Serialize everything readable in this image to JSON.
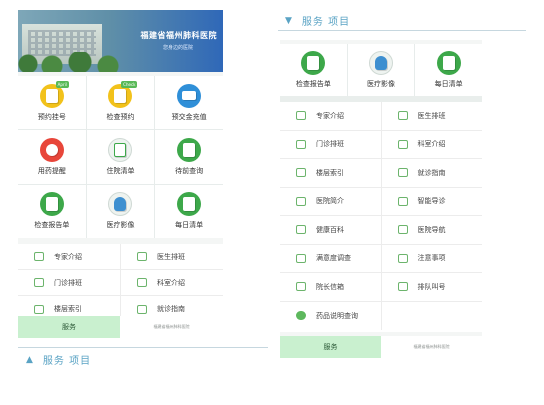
{
  "left_phone": {
    "banner": {
      "title": "福建省福州肺科医院",
      "subtitle": "您身边的医院"
    },
    "top_grid": [
      {
        "label": "预约挂号",
        "icon": "calendar-icon",
        "badge": "April",
        "color": "#f2c21b"
      },
      {
        "label": "检查预约",
        "icon": "calendar-check-icon",
        "badge": "Check",
        "color": "#f2c21b"
      },
      {
        "label": "预交金充值",
        "icon": "wallet-icon",
        "badge": "",
        "color": "#2f8fd8"
      },
      {
        "label": "用药提醒",
        "icon": "alarm-clock-icon",
        "badge": "",
        "color": "#2f8fd8"
      },
      {
        "label": "住院清单",
        "icon": "clipboard-icon",
        "badge": "",
        "color": "#eef3f0"
      },
      {
        "label": "待前查询",
        "icon": "search-doc-icon",
        "badge": "",
        "color": "#3da84a"
      },
      {
        "label": "检查报告单",
        "icon": "report-icon",
        "badge": "",
        "color": "#3da84a"
      },
      {
        "label": "医疗影像",
        "icon": "lungs-icon",
        "badge": "",
        "color": "#eef3f0"
      },
      {
        "label": "每日清单",
        "icon": "daily-list-icon",
        "badge": "",
        "color": "#3da84a"
      }
    ],
    "list": [
      [
        "专家介绍",
        "医生排班"
      ],
      [
        "门诊排班",
        "科室介绍"
      ],
      [
        "楼层索引",
        "就诊指南"
      ]
    ],
    "service_button": "服务",
    "footnote": "福建省福州肺科医院"
  },
  "section_header_left": {
    "label": "服务 项目"
  },
  "section_header_right": {
    "label": "服务 项目"
  },
  "right_phone": {
    "top_grid": [
      {
        "label": "检查报告单",
        "icon": "report-icon",
        "color": "#3da84a"
      },
      {
        "label": "医疗影像",
        "icon": "lungs-icon",
        "color": "#eef3f0"
      },
      {
        "label": "每日清单",
        "icon": "daily-list-icon",
        "color": "#3da84a"
      }
    ],
    "list": [
      [
        "专家介绍",
        "医生排班"
      ],
      [
        "门诊排班",
        "科室介绍"
      ],
      [
        "楼层索引",
        "就诊指南"
      ],
      [
        "医院简介",
        "智能导诊"
      ],
      [
        "健康百科",
        "医院导航"
      ],
      [
        "满意度调查",
        "注意事项"
      ],
      [
        "院长信箱",
        "排队叫号"
      ],
      [
        "药品说明查询",
        ""
      ]
    ],
    "service_button": "服务",
    "footnote": "福建省福州肺科医院"
  }
}
